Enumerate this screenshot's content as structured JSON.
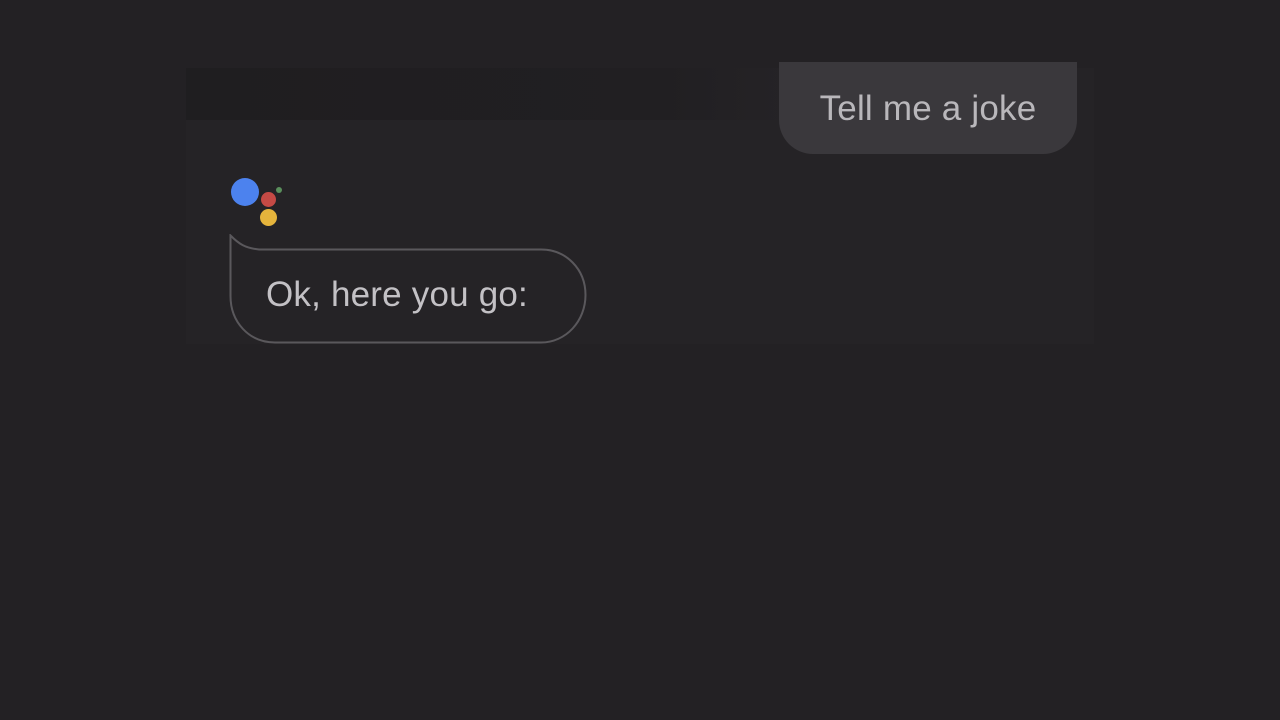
{
  "conversation": {
    "user_query": "Tell me a joke",
    "assistant_reply": "Ok, here you go:"
  },
  "assistant_logo": {
    "icon": "google-assistant-icon",
    "colors": {
      "blue": "#4c82ee",
      "red": "#c54a45",
      "yellow": "#e5b43c",
      "green": "#5a8f5c"
    }
  },
  "theme": {
    "background": "#232124",
    "user_bubble": "#3a383c",
    "assistant_bubble_border": "#5a585c"
  }
}
